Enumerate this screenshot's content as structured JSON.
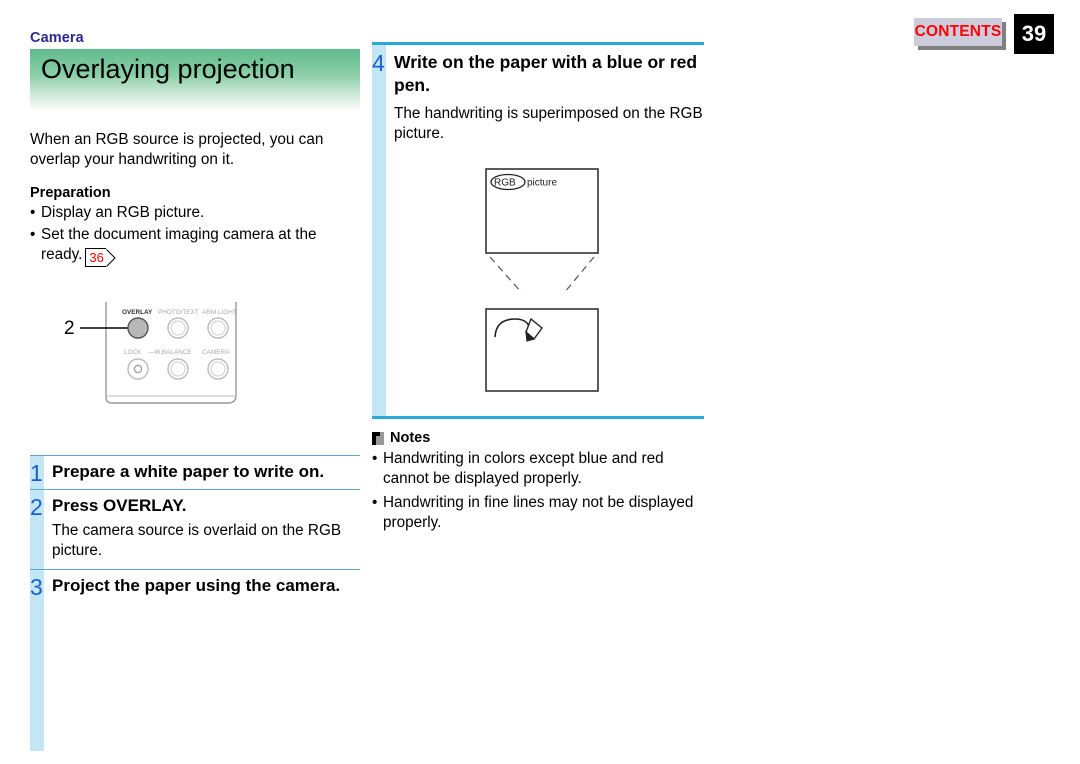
{
  "header": {
    "section_label": "Camera",
    "title": "Overlaying projection",
    "contents_label": "CONTENTS",
    "page_number": "39"
  },
  "colors": {
    "banner_green": "#5fba8c",
    "section_label_blue": "#2b2b8f",
    "step_number_blue": "#1a5fd0",
    "stripe_blue": "#c3e6f4",
    "rule_blue": "#2aa8d8",
    "contents_red": "#ff0000",
    "page_ref_red": "#ff0000"
  },
  "intro": {
    "paragraph": "When an RGB source is projected, you can overlap your handwriting on it.",
    "preparation_heading": "Preparation",
    "bullets": [
      {
        "text": "Display an RGB picture.",
        "page_ref": null
      },
      {
        "text": "Set the document imaging camera at the ready.",
        "page_ref": "36"
      }
    ]
  },
  "panel_figure": {
    "callout_number": "2",
    "buttons_top": [
      "OVERLAY",
      "PHOTO/TEXT",
      "ARM LIGHT"
    ],
    "buttons_bottom": [
      "LOCK",
      "W.BALANCE",
      "CAMERA"
    ],
    "w_balance_prefix": "—"
  },
  "steps_left": [
    {
      "number": "1",
      "title": "Prepare a white paper to write on.",
      "body": ""
    },
    {
      "number": "2",
      "title": "Press OVERLAY.",
      "body": "The camera source is overlaid on the RGB picture."
    },
    {
      "number": "3",
      "title": "Project the paper using the camera.",
      "body": ""
    }
  ],
  "step_right": {
    "number": "4",
    "title": "Write on the paper with a blue or red pen.",
    "body": "The handwriting is superimposed on the RGB picture."
  },
  "rgb_figure": {
    "circled_label": "RGB",
    "label_suffix": "picture"
  },
  "notes": {
    "heading": "Notes",
    "items": [
      "Handwriting in colors except blue and red cannot be displayed properly.",
      "Handwriting in fine lines may not be displayed properly."
    ]
  }
}
